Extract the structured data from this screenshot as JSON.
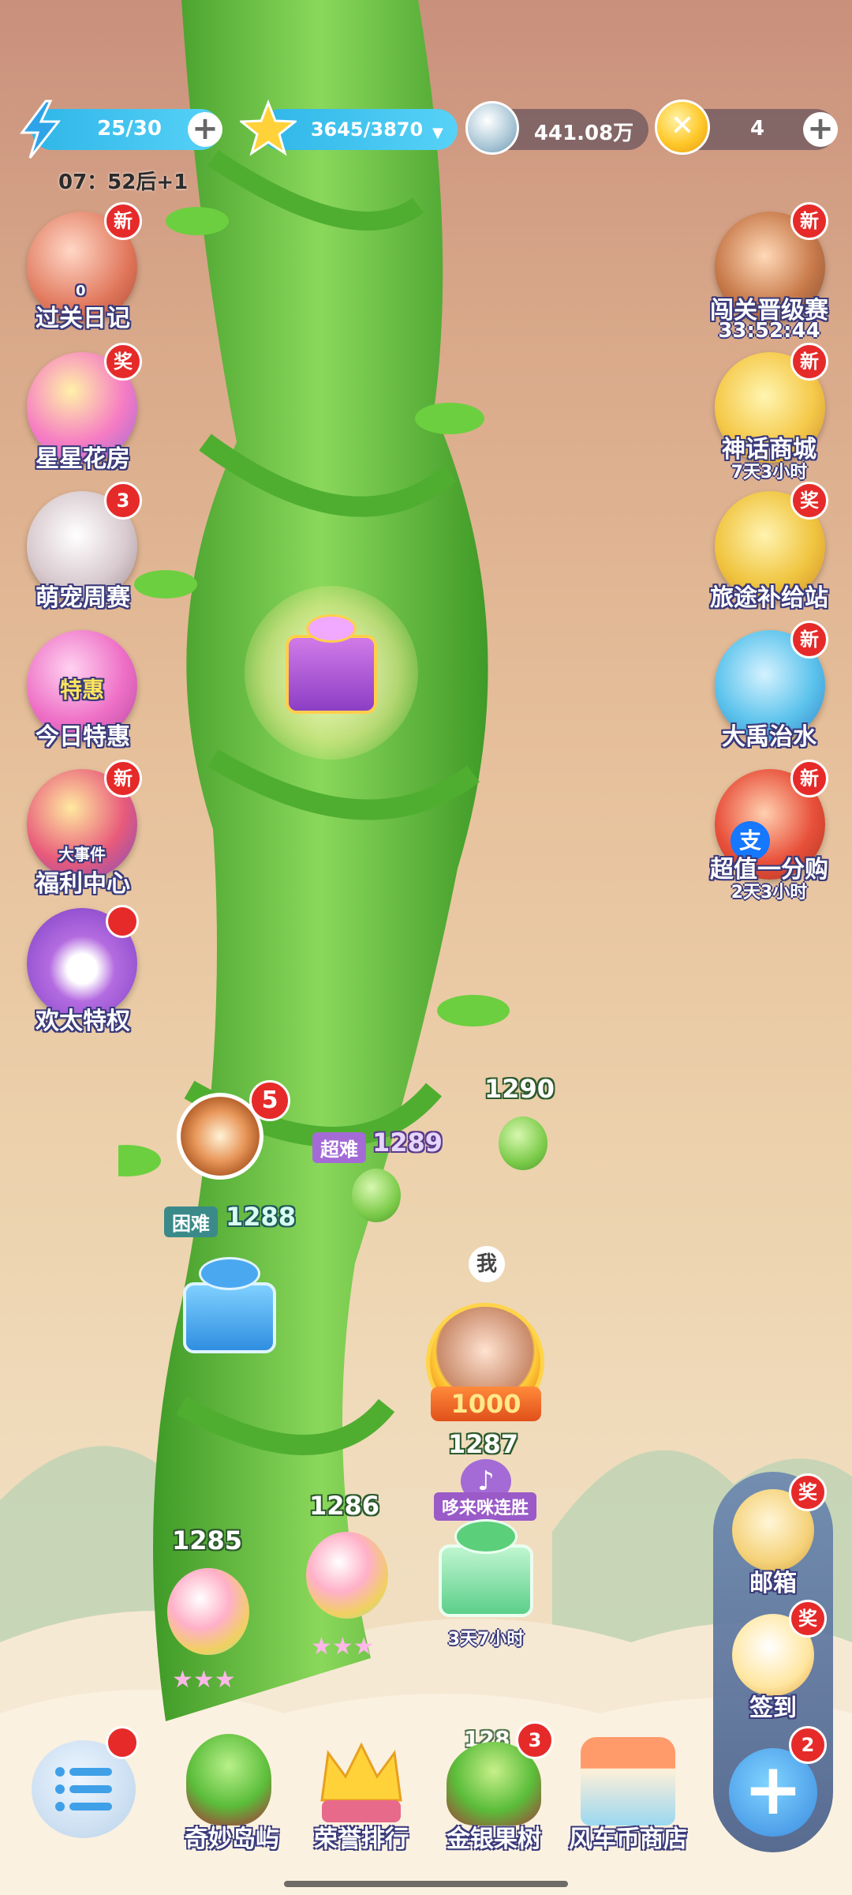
{
  "resources": {
    "energy": {
      "value": "25/30",
      "icon": "lightning-icon"
    },
    "energy_timer": "07：52后+1",
    "stars": {
      "value": "3645/3870",
      "icon": "star-icon"
    },
    "silver": {
      "value": "441.08万",
      "icon": "silver-coin-icon"
    },
    "gold": {
      "value": "4",
      "icon": "gold-coin-icon"
    }
  },
  "left_menu": [
    {
      "label": "过关日记",
      "badge": "新",
      "counter": "0",
      "icon": "diary-icon"
    },
    {
      "label": "星星花房",
      "badge": "奖",
      "icon": "flower-house-icon"
    },
    {
      "label": "萌宠周赛",
      "badge": "3",
      "icon": "pet-cat-icon"
    },
    {
      "label": "今日特惠",
      "inner": "特惠",
      "icon": "shop-sale-icon"
    },
    {
      "label": "福利中心",
      "badge": "新",
      "inner": "大事件",
      "icon": "gift-center-icon"
    },
    {
      "label": "欢太特权",
      "badge": "",
      "icon": "privilege-icon"
    }
  ],
  "right_menu": [
    {
      "label": "闯关晋级赛",
      "badge": "新",
      "sub": "33:52:44",
      "icon": "tournament-icon"
    },
    {
      "label": "神话商城",
      "badge": "新",
      "sub": "7天3小时",
      "icon": "myth-shop-icon"
    },
    {
      "label": "旅途补给站",
      "badge": "奖",
      "icon": "supply-station-icon"
    },
    {
      "label": "大禹治水",
      "badge": "新",
      "icon": "dayu-icon"
    },
    {
      "label": "超值一分购",
      "badge": "新",
      "sub": "2天3小时",
      "inner": "支",
      "icon": "penny-deal-icon"
    }
  ],
  "levels": {
    "l1285": "1285",
    "l1286": "1286",
    "l1287": "1287",
    "l1288": "1288",
    "l1288_tag": "困难",
    "l1289": "1289",
    "l1289_tag": "超难",
    "l1290": "1290",
    "partial": "128"
  },
  "player": {
    "marker": "我",
    "score": "1000"
  },
  "event": {
    "label": "哆来咪连胜",
    "timer": "3天7小时"
  },
  "wheel": {
    "badge": "5"
  },
  "side_panel": [
    {
      "label": "邮箱",
      "badge": "奖",
      "icon": "mail-icon"
    },
    {
      "label": "签到",
      "badge": "奖",
      "icon": "calendar-icon"
    },
    {
      "label": "",
      "badge": "2",
      "icon": "plus-icon"
    }
  ],
  "bottom_nav": [
    {
      "label": "奇妙岛屿",
      "icon": "island-icon"
    },
    {
      "label": "荣誉排行",
      "icon": "crown-icon"
    },
    {
      "label": "金银果树",
      "icon": "fruit-tree-icon",
      "badge": "3"
    },
    {
      "label": "风车币商店",
      "icon": "windmill-shop-icon"
    }
  ],
  "menu_button": {
    "icon": "menu-list-icon"
  },
  "colors": {
    "accent_red": "#e62a2a",
    "vine_green": "#5fbf3a",
    "energy_blue": "#2fb6e8"
  }
}
